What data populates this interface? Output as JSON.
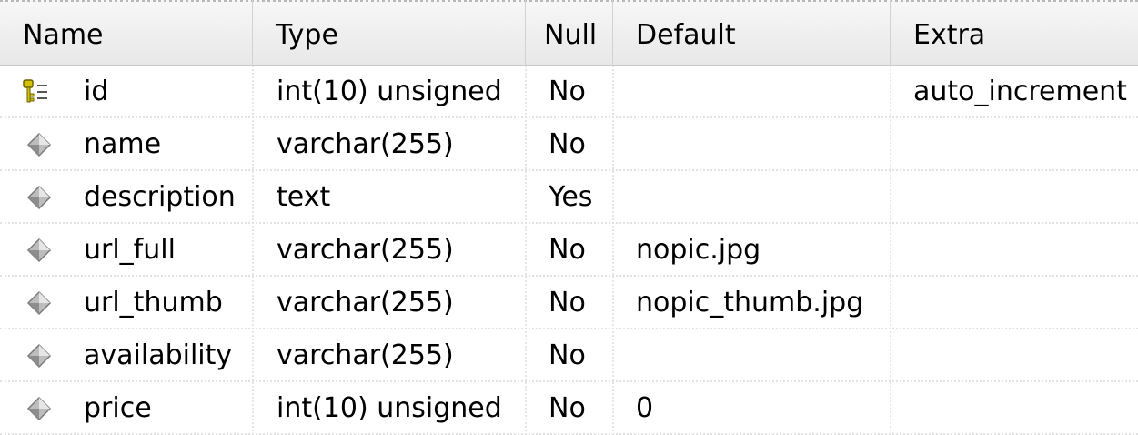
{
  "columns": {
    "name": "Name",
    "type": "Type",
    "null": "Null",
    "default": "Default",
    "extra": "Extra"
  },
  "rows": [
    {
      "icon": "primary-key-icon",
      "name": "id",
      "type": "int(10) unsigned",
      "null": "No",
      "default": "",
      "extra": "auto_increment"
    },
    {
      "icon": "field-icon",
      "name": "name",
      "type": "varchar(255)",
      "null": "No",
      "default": "",
      "extra": ""
    },
    {
      "icon": "field-icon",
      "name": "description",
      "type": "text",
      "null": "Yes",
      "default": "",
      "extra": ""
    },
    {
      "icon": "field-icon",
      "name": "url_full",
      "type": "varchar(255)",
      "null": "No",
      "default": "nopic.jpg",
      "extra": ""
    },
    {
      "icon": "field-icon",
      "name": "url_thumb",
      "type": "varchar(255)",
      "null": "No",
      "default": "nopic_thumb.jpg",
      "extra": ""
    },
    {
      "icon": "field-icon",
      "name": "availability",
      "type": "varchar(255)",
      "null": "No",
      "default": "",
      "extra": ""
    },
    {
      "icon": "field-icon",
      "name": "price",
      "type": "int(10) unsigned",
      "null": "No",
      "default": "0",
      "extra": ""
    }
  ],
  "colors": {
    "key_icon": "#d6c200",
    "field_icon": "#9a9a9a"
  }
}
